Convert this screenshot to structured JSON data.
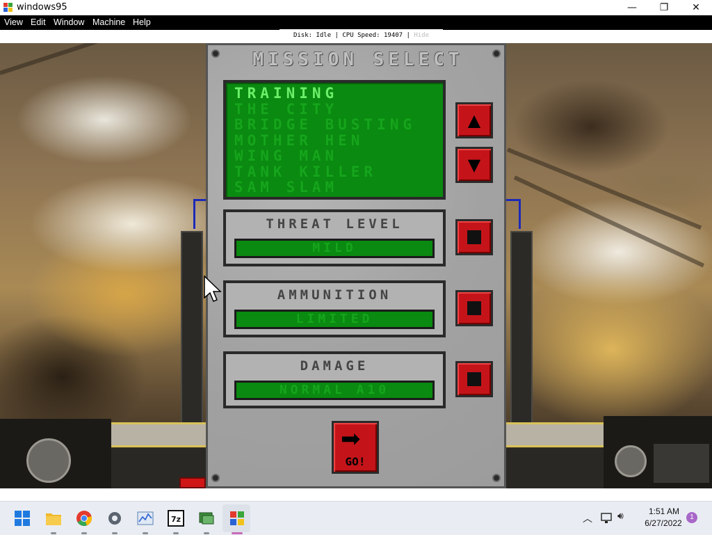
{
  "window": {
    "title": "windows95",
    "controls": [
      "minimize",
      "maximize",
      "close"
    ]
  },
  "menubar": {
    "items": [
      "View",
      "Edit",
      "Window",
      "Machine",
      "Help"
    ]
  },
  "status": {
    "text": "Disk: Idle | CPU Speed: 19407 | ",
    "hide_label": "Hide"
  },
  "mission_panel": {
    "title": "MISSION SELECT",
    "missions": [
      "TRAINING",
      "THE CITY",
      "BRIDGE BUSTING",
      "MOTHER HEN",
      "WING MAN",
      "TANK KILLER",
      "SAM SLAM"
    ],
    "selected_mission": "TRAINING",
    "threat_level": {
      "label": "THREAT LEVEL",
      "value": "MILD"
    },
    "ammunition": {
      "label": "AMMUNITION",
      "value": "LIMITED"
    },
    "damage": {
      "label": "DAMAGE",
      "value": "NORMAL A10"
    },
    "go_label": "GO!",
    "colors": {
      "panel_bg": "#a9a9a9",
      "list_bg": "#0a8a10",
      "selected_text": "#6cf06a",
      "button_red": "#c4141a"
    }
  },
  "taskbar": {
    "apps": [
      "start-icon",
      "file-explorer-icon",
      "chrome-icon",
      "settings-icon",
      "performance-monitor-icon",
      "7zip-icon",
      "app-icon",
      "windows95-icon"
    ],
    "clock": {
      "time": "1:51 AM",
      "date": "6/27/2022"
    },
    "notification_count": "1"
  }
}
